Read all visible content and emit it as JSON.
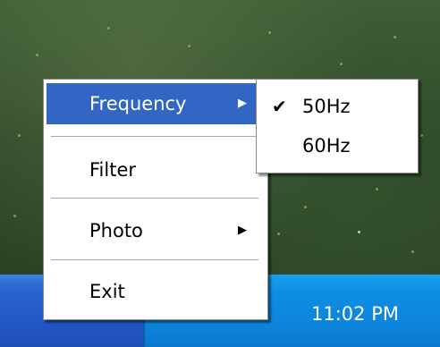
{
  "context_menu": {
    "items": [
      {
        "label": "Frequency",
        "has_submenu": true,
        "highlighted": true
      },
      {
        "label": "Filter",
        "has_submenu": false
      },
      {
        "label": "Photo",
        "has_submenu": true
      },
      {
        "label": "Exit",
        "has_submenu": false
      }
    ],
    "submenu_arrow": "▶"
  },
  "frequency_submenu": {
    "items": [
      {
        "label": "50Hz",
        "checked": true,
        "check_glyph": "✔"
      },
      {
        "label": "60Hz",
        "checked": false
      }
    ]
  },
  "taskbar": {
    "clock": "11:02 PM",
    "tray_icons": [
      "network-icon",
      "volume-muted-icon",
      "app-tray-icon"
    ]
  },
  "colors": {
    "menu_highlight": "#3166c5",
    "taskbar_blue": "#2458c7",
    "tray_blue": "#0f8fe4"
  }
}
